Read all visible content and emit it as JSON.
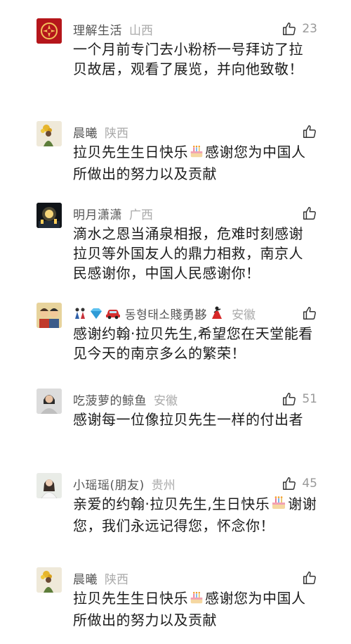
{
  "comments": [
    {
      "username": "理解生活",
      "region": "山西",
      "likes": "23",
      "text": "一个月前专门去小粉桥一号拜访了拉贝故居，观看了展览，并向他致敬！",
      "avatar_icon": "red-ornament-avatar"
    },
    {
      "username": "晨曦",
      "region": "陕西",
      "likes": "",
      "text_before": "拉贝先生生日快乐",
      "text_after": "感谢您为中国人所做出的努力以及贡献",
      "avatar_icon": "flower-girl-avatar"
    },
    {
      "username": "明月潇潇",
      "region": "广西",
      "likes": "",
      "text": "滴水之恩当涌泉相报，危难时刻感谢拉贝等外国友人的鼎力相救，南京人民感谢你，中国人民感谢你！",
      "avatar_icon": "night-lights-avatar"
    },
    {
      "username": "동형태소賤勇夦",
      "region": "安徽",
      "likes": "",
      "text": "感谢约翰·拉贝先生,希望您在天堂能看见今天的南京多么的繁荣！",
      "avatar_icon": "cartoon-avatar",
      "badge_icons": [
        "figures-badge-icon",
        "diamond-badge-icon",
        "car-badge-icon"
      ],
      "trailing_icon": "dancer-icon"
    },
    {
      "username": "吃菠萝的鲸鱼",
      "region": "安徽",
      "likes": "51",
      "text": "感谢每一位像拉贝先生一样的付出者",
      "avatar_icon": "woman-portrait-avatar"
    },
    {
      "username": "小瑶瑶(朋友)",
      "region": "贵州",
      "likes": "45",
      "text_before": "亲爱的约翰·拉贝先生,生日快乐",
      "text_after": "谢谢您，我们永远记得您，怀念你！",
      "avatar_icon": "woman-white-avatar"
    },
    {
      "username": "晨曦",
      "region": "陕西",
      "likes": "",
      "text_before": "拉贝先生生日快乐",
      "text_after": "感谢您为中国人所做出的努力以及贡献",
      "avatar_icon": "flower-girl-avatar"
    }
  ],
  "colors": {
    "username": "#555555",
    "region": "#aaaaaa",
    "text": "#1c1c1c",
    "like_icon": "#333333"
  }
}
